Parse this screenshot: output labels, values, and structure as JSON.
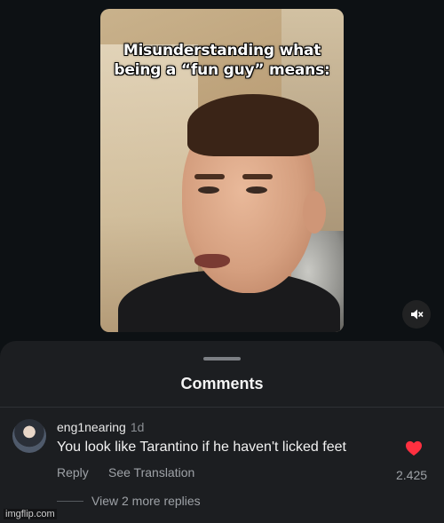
{
  "video": {
    "caption": "Misunderstanding what being a “fun guy” means:",
    "mute_icon": "speaker-muted-icon"
  },
  "comments_sheet": {
    "title": "Comments",
    "comment": {
      "username": "eng1nearing",
      "time": "1d",
      "text": "You look like Tarantino if he haven't licked feet",
      "reply_label": "Reply",
      "translation_label": "See Translation",
      "like_count": "2.425",
      "like_icon": "heart-icon",
      "like_color": "#ff3040",
      "view_replies_label": "View 2 more replies"
    }
  },
  "watermark": "imgflip.com"
}
